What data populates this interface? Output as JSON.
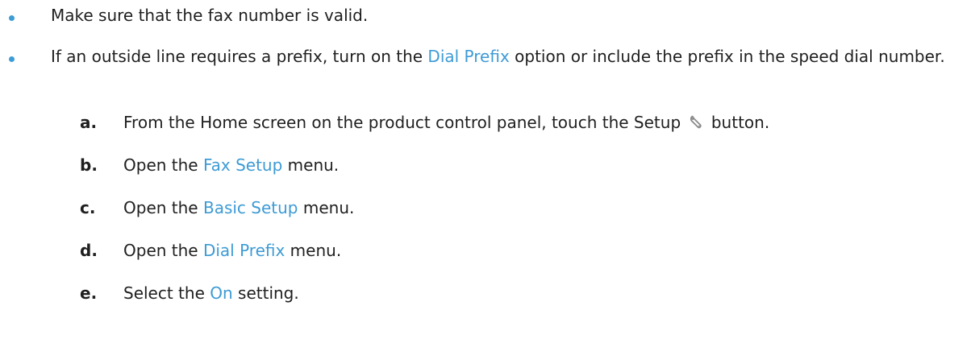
{
  "colors": {
    "accent": "#3d9bd5",
    "text": "#1f1f1f"
  },
  "bullets": [
    {
      "text": "Make sure that the fax number is valid."
    },
    {
      "before": "If an outside line requires a prefix, turn on the ",
      "link": "Dial Prefix",
      "after": " option or include the prefix in the speed dial number."
    }
  ],
  "steps": [
    {
      "letter": "a.",
      "before": "From the Home screen on the product control panel, touch the Setup ",
      "icon": "wrench-icon",
      "after": " button."
    },
    {
      "letter": "b.",
      "before": "Open the ",
      "link": "Fax Setup",
      "after": " menu."
    },
    {
      "letter": "c.",
      "before": "Open the ",
      "link": "Basic Setup",
      "after": " menu."
    },
    {
      "letter": "d.",
      "before": "Open the ",
      "link": "Dial Prefix",
      "after": " menu."
    },
    {
      "letter": "e.",
      "before": "Select the ",
      "link": "On",
      "after": " setting."
    }
  ]
}
